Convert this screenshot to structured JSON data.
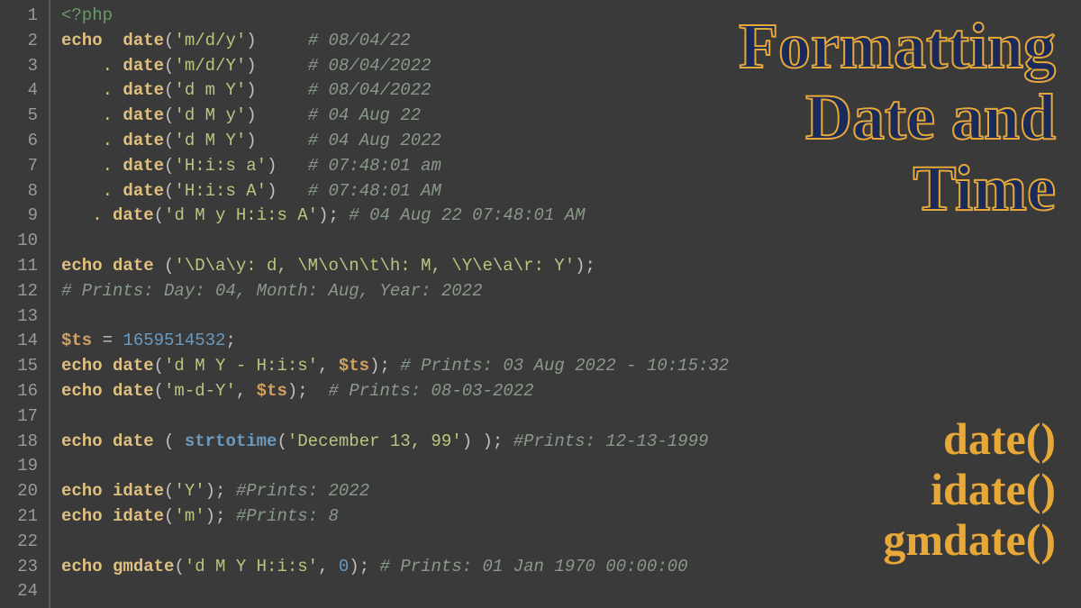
{
  "gutter": [
    "1",
    "2",
    "3",
    "4",
    "5",
    "6",
    "7",
    "8",
    "9",
    "10",
    "11",
    "12",
    "13",
    "14",
    "15",
    "16",
    "17",
    "18",
    "19",
    "20",
    "21",
    "22",
    "23",
    "24"
  ],
  "title": {
    "l1": "Formatting",
    "l2": "Date and",
    "l3": "Time"
  },
  "fns": {
    "a": "date()",
    "b": "idate()",
    "c": "gmdate()"
  },
  "code": {
    "l1": {
      "open": "<?php"
    },
    "l2": {
      "kw": "echo",
      "sp1": "  ",
      "fn": "date",
      "p1": "(",
      "s": "'m/d/y'",
      "p2": ")",
      "sp2": "     ",
      "c": "# 08/04/22"
    },
    "l3": {
      "pad": "    ",
      "dot": ". ",
      "fn": "date",
      "p1": "(",
      "s": "'m/d/Y'",
      "p2": ")",
      "sp2": "     ",
      "c": "# 08/04/2022"
    },
    "l4": {
      "pad": "    ",
      "dot": ". ",
      "fn": "date",
      "p1": "(",
      "s": "'d m Y'",
      "p2": ")",
      "sp2": "     ",
      "c": "# 08/04/2022"
    },
    "l5": {
      "pad": "    ",
      "dot": ". ",
      "fn": "date",
      "p1": "(",
      "s": "'d M y'",
      "p2": ")",
      "sp2": "     ",
      "c": "# 04 Aug 22"
    },
    "l6": {
      "pad": "    ",
      "dot": ". ",
      "fn": "date",
      "p1": "(",
      "s": "'d M Y'",
      "p2": ")",
      "sp2": "     ",
      "c": "# 04 Aug 2022"
    },
    "l7": {
      "pad": "    ",
      "dot": ". ",
      "fn": "date",
      "p1": "(",
      "s": "'H:i:s a'",
      "p2": ")",
      "sp2": "   ",
      "c": "# 07:48:01 am"
    },
    "l8": {
      "pad": "    ",
      "dot": ". ",
      "fn": "date",
      "p1": "(",
      "s": "'H:i:s A'",
      "p2": ")",
      "sp2": "   ",
      "c": "# 07:48:01 AM"
    },
    "l9": {
      "pad": "   ",
      "dot": ". ",
      "fn": "date",
      "p1": "(",
      "s": "'d M y H:i:s A'",
      "p2": ");",
      "sp2": " ",
      "c": "# 04 Aug 22 07:48:01 AM"
    },
    "l11": {
      "kw": "echo",
      "sp": " ",
      "fn": "date",
      "sp2": " ",
      "p1": "(",
      "s": "'\\D\\a\\y: d, \\M\\o\\n\\t\\h: M, \\Y\\e\\a\\r: Y'",
      "p2": ");"
    },
    "l12": {
      "c": "# Prints: Day: 04, Month: Aug, Year: 2022"
    },
    "l14": {
      "v": "$ts",
      "eq": " = ",
      "n": "1659514532",
      "p": ";"
    },
    "l15": {
      "kw": "echo",
      "sp": " ",
      "fn": "date",
      "p1": "(",
      "s": "'d M Y - H:i:s'",
      "cm": ", ",
      "v": "$ts",
      "p2": ");",
      "sp2": " ",
      "c": "# Prints: 03 Aug 2022 - 10:15:32"
    },
    "l16": {
      "kw": "echo",
      "sp": " ",
      "fn": "date",
      "p1": "(",
      "s": "'m-d-Y'",
      "cm": ", ",
      "v": "$ts",
      "p2": ");",
      "sp2": "  ",
      "c": "# Prints: 08-03-2022"
    },
    "l18": {
      "kw": "echo",
      "sp": " ",
      "fn": "date",
      "sp2": " ",
      "p1": "( ",
      "fn2": "strtotime",
      "p2": "(",
      "s": "'December 13, 99'",
      "p3": ") );",
      "sp3": " ",
      "c": "#Prints: 12-13-1999"
    },
    "l20": {
      "kw": "echo",
      "sp": " ",
      "fn": "idate",
      "p1": "(",
      "s": "'Y'",
      "p2": ");",
      "sp2": " ",
      "c": "#Prints: 2022"
    },
    "l21": {
      "kw": "echo",
      "sp": " ",
      "fn": "idate",
      "p1": "(",
      "s": "'m'",
      "p2": ");",
      "sp2": " ",
      "c": "#Prints: 8"
    },
    "l23": {
      "kw": "echo",
      "sp": " ",
      "fn": "gmdate",
      "p1": "(",
      "s": "'d M Y H:i:s'",
      "cm": ", ",
      "n": "0",
      "p2": ");",
      "sp2": " ",
      "c": "# Prints: 01 Jan 1970 00:00:00"
    }
  }
}
